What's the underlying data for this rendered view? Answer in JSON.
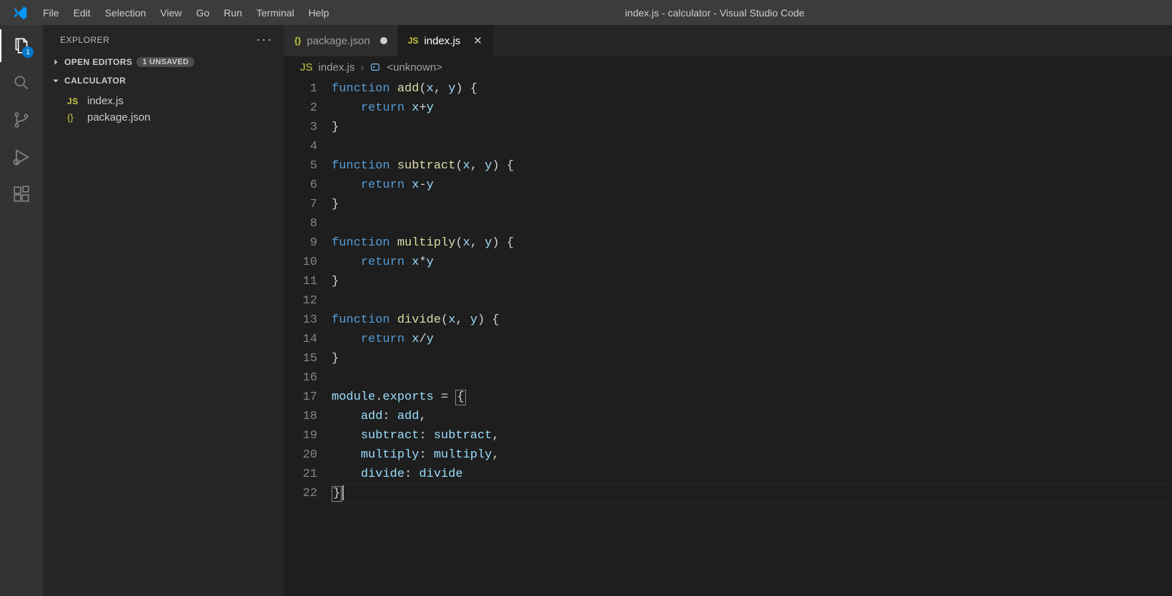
{
  "window": {
    "title": "index.js - calculator - Visual Studio Code"
  },
  "menu": {
    "items": [
      "File",
      "Edit",
      "Selection",
      "View",
      "Go",
      "Run",
      "Terminal",
      "Help"
    ]
  },
  "activitybar": {
    "explorer_badge": "1"
  },
  "sidebar": {
    "title": "EXPLORER",
    "open_editors_label": "OPEN EDITORS",
    "unsaved_badge": "1 UNSAVED",
    "folder_name": "CALCULATOR",
    "files": [
      {
        "icon": "js",
        "name": "index.js"
      },
      {
        "icon": "json",
        "name": "package.json"
      }
    ]
  },
  "tabs": [
    {
      "icon": "json",
      "label": "package.json",
      "dirty": true,
      "active": false
    },
    {
      "icon": "js",
      "label": "index.js",
      "dirty": false,
      "active": true
    }
  ],
  "breadcrumb": {
    "file_icon": "js",
    "file": "index.js",
    "symbol": "<unknown>"
  },
  "editor": {
    "line_count": 22,
    "lines": [
      [
        {
          "t": "kw",
          "s": "function "
        },
        {
          "t": "fn",
          "s": "add"
        },
        {
          "t": "pn",
          "s": "("
        },
        {
          "t": "var",
          "s": "x"
        },
        {
          "t": "pn",
          "s": ", "
        },
        {
          "t": "var",
          "s": "y"
        },
        {
          "t": "pn",
          "s": ") {"
        }
      ],
      [
        {
          "t": "pn",
          "s": "    "
        },
        {
          "t": "kw",
          "s": "return "
        },
        {
          "t": "var",
          "s": "x"
        },
        {
          "t": "op",
          "s": "+"
        },
        {
          "t": "var",
          "s": "y"
        }
      ],
      [
        {
          "t": "pn",
          "s": "}"
        }
      ],
      [],
      [
        {
          "t": "kw",
          "s": "function "
        },
        {
          "t": "fn",
          "s": "subtract"
        },
        {
          "t": "pn",
          "s": "("
        },
        {
          "t": "var",
          "s": "x"
        },
        {
          "t": "pn",
          "s": ", "
        },
        {
          "t": "var",
          "s": "y"
        },
        {
          "t": "pn",
          "s": ") {"
        }
      ],
      [
        {
          "t": "pn",
          "s": "    "
        },
        {
          "t": "kw",
          "s": "return "
        },
        {
          "t": "var",
          "s": "x"
        },
        {
          "t": "op",
          "s": "-"
        },
        {
          "t": "var",
          "s": "y"
        }
      ],
      [
        {
          "t": "pn",
          "s": "}"
        }
      ],
      [],
      [
        {
          "t": "kw",
          "s": "function "
        },
        {
          "t": "fn",
          "s": "multiply"
        },
        {
          "t": "pn",
          "s": "("
        },
        {
          "t": "var",
          "s": "x"
        },
        {
          "t": "pn",
          "s": ", "
        },
        {
          "t": "var",
          "s": "y"
        },
        {
          "t": "pn",
          "s": ") {"
        }
      ],
      [
        {
          "t": "pn",
          "s": "    "
        },
        {
          "t": "kw",
          "s": "return "
        },
        {
          "t": "var",
          "s": "x"
        },
        {
          "t": "op",
          "s": "*"
        },
        {
          "t": "var",
          "s": "y"
        }
      ],
      [
        {
          "t": "pn",
          "s": "}"
        }
      ],
      [],
      [
        {
          "t": "kw",
          "s": "function "
        },
        {
          "t": "fn",
          "s": "divide"
        },
        {
          "t": "pn",
          "s": "("
        },
        {
          "t": "var",
          "s": "x"
        },
        {
          "t": "pn",
          "s": ", "
        },
        {
          "t": "var",
          "s": "y"
        },
        {
          "t": "pn",
          "s": ") {"
        }
      ],
      [
        {
          "t": "pn",
          "s": "    "
        },
        {
          "t": "kw",
          "s": "return "
        },
        {
          "t": "var",
          "s": "x"
        },
        {
          "t": "op",
          "s": "/"
        },
        {
          "t": "var",
          "s": "y"
        }
      ],
      [
        {
          "t": "pn",
          "s": "}"
        }
      ],
      [],
      [
        {
          "t": "var",
          "s": "module"
        },
        {
          "t": "pn",
          "s": "."
        },
        {
          "t": "var",
          "s": "exports"
        },
        {
          "t": "pn",
          "s": " = "
        },
        {
          "t": "box",
          "s": "{"
        }
      ],
      [
        {
          "t": "pn",
          "s": "    "
        },
        {
          "t": "var",
          "s": "add"
        },
        {
          "t": "pn",
          "s": ": "
        },
        {
          "t": "var",
          "s": "add"
        },
        {
          "t": "pn",
          "s": ","
        }
      ],
      [
        {
          "t": "pn",
          "s": "    "
        },
        {
          "t": "var",
          "s": "subtract"
        },
        {
          "t": "pn",
          "s": ": "
        },
        {
          "t": "var",
          "s": "subtract"
        },
        {
          "t": "pn",
          "s": ","
        }
      ],
      [
        {
          "t": "pn",
          "s": "    "
        },
        {
          "t": "var",
          "s": "multiply"
        },
        {
          "t": "pn",
          "s": ": "
        },
        {
          "t": "var",
          "s": "multiply"
        },
        {
          "t": "pn",
          "s": ","
        }
      ],
      [
        {
          "t": "pn",
          "s": "    "
        },
        {
          "t": "var",
          "s": "divide"
        },
        {
          "t": "pn",
          "s": ": "
        },
        {
          "t": "var",
          "s": "divide"
        }
      ],
      [
        {
          "t": "box",
          "s": "}"
        },
        {
          "t": "cursor",
          "s": ""
        }
      ]
    ],
    "current_line_index": 21
  }
}
